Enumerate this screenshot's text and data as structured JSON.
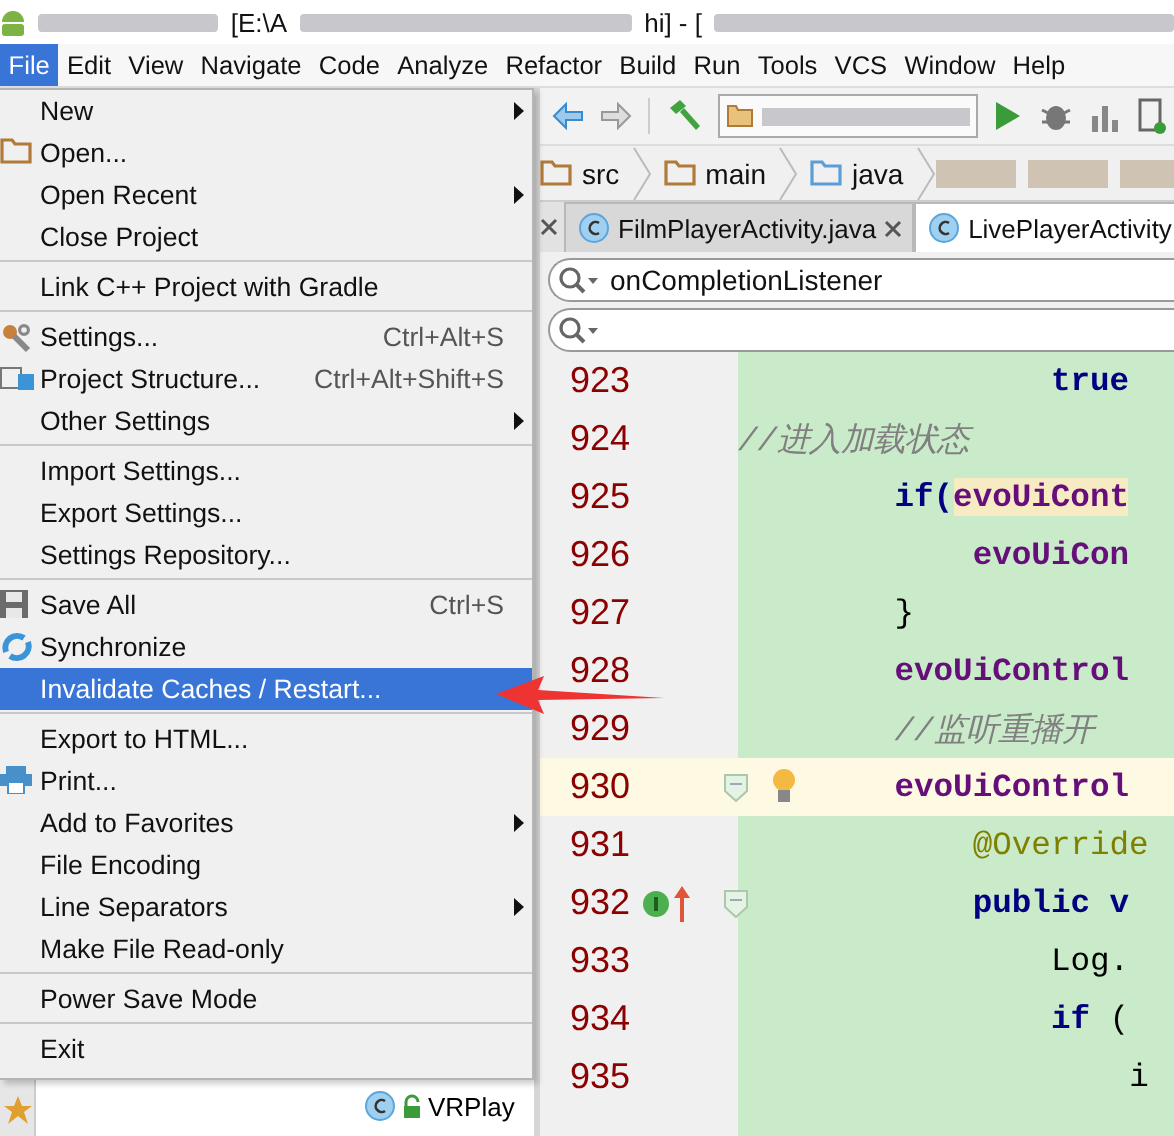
{
  "title_bar": {
    "parts": [
      "[E:\\A",
      "hi] - ["
    ]
  },
  "menu_bar": [
    {
      "label": "File",
      "selected": true
    },
    {
      "label": "Edit",
      "selected": false
    },
    {
      "label": "View",
      "selected": false
    },
    {
      "label": "Navigate",
      "selected": false
    },
    {
      "label": "Code",
      "selected": false
    },
    {
      "label": "Analyze",
      "selected": false
    },
    {
      "label": "Refactor",
      "selected": false
    },
    {
      "label": "Build",
      "selected": false
    },
    {
      "label": "Run",
      "selected": false
    },
    {
      "label": "Tools",
      "selected": false
    },
    {
      "label": "VCS",
      "selected": false
    },
    {
      "label": "Window",
      "selected": false
    },
    {
      "label": "Help",
      "selected": false
    }
  ],
  "breadcrumbs": [
    "src",
    "main",
    "java"
  ],
  "tabs": [
    {
      "label": "FilmPlayerActivity.java",
      "selected": false
    },
    {
      "label": "LivePlayerActivity",
      "selected": true
    }
  ],
  "search_fields": [
    {
      "value": "onCompletionListener"
    }
  ],
  "code": {
    "lines": [
      {
        "number": "923",
        "highlighted": false,
        "tokens": [
          {
            "text": "                true",
            "kind": "keyword"
          }
        ]
      },
      {
        "number": "924",
        "highlighted": false,
        "tokens": [
          {
            "text": "//进入加载状态",
            "kind": "comment"
          }
        ]
      },
      {
        "number": "925",
        "highlighted": false,
        "tokens": [
          {
            "text": "        if(",
            "kind": "keyword"
          },
          {
            "text": "evoUiCont",
            "kind": "match"
          }
        ]
      },
      {
        "number": "926",
        "highlighted": false,
        "tokens": [
          {
            "text": "            evoUiCon",
            "kind": "field"
          }
        ]
      },
      {
        "number": "927",
        "highlighted": false,
        "tokens": [
          {
            "text": "        }",
            "kind": "plain"
          }
        ]
      },
      {
        "number": "928",
        "highlighted": false,
        "tokens": [
          {
            "text": "        evoUiControl",
            "kind": "field"
          }
        ]
      },
      {
        "number": "929",
        "highlighted": false,
        "tokens": [
          {
            "text": "        //监听重播开",
            "kind": "comment"
          }
        ]
      },
      {
        "number": "930",
        "highlighted": true,
        "tokens": [
          {
            "text": "        evoUiControl",
            "kind": "field"
          }
        ]
      },
      {
        "number": "931",
        "highlighted": false,
        "tokens": [
          {
            "text": "            @Override",
            "kind": "annotation"
          }
        ]
      },
      {
        "number": "932",
        "highlighted": false,
        "tokens": [
          {
            "text": "            public v",
            "kind": "keyword"
          }
        ]
      },
      {
        "number": "933",
        "highlighted": false,
        "tokens": [
          {
            "text": "                Log.",
            "kind": "plain"
          }
        ]
      },
      {
        "number": "934",
        "highlighted": false,
        "tokens": [
          {
            "text": "                if",
            "kind": "keyword"
          },
          {
            "text": " (",
            "kind": "plain"
          }
        ]
      },
      {
        "number": "935",
        "highlighted": false,
        "tokens": [
          {
            "text": "                    i",
            "kind": "plain"
          }
        ]
      }
    ]
  },
  "file_menu": {
    "groups": [
      [
        {
          "label": "New",
          "submenu": true,
          "selected": false
        },
        {
          "label": "Open...",
          "submenu": false,
          "selected": false
        },
        {
          "label": "Open Recent",
          "submenu": true,
          "selected": false
        },
        {
          "label": "Close Project",
          "submenu": false,
          "selected": false
        }
      ],
      [
        {
          "label": "Link C++ Project with Gradle",
          "submenu": false,
          "selected": false
        }
      ],
      [
        {
          "label": "Settings...",
          "shortcut": "Ctrl+Alt+S",
          "submenu": false,
          "selected": false
        },
        {
          "label": "Project Structure...",
          "shortcut": "Ctrl+Alt+Shift+S",
          "submenu": false,
          "selected": false
        },
        {
          "label": "Other Settings",
          "submenu": true,
          "selected": false
        }
      ],
      [
        {
          "label": "Import Settings...",
          "submenu": false,
          "selected": false
        },
        {
          "label": "Export Settings...",
          "submenu": false,
          "selected": false
        },
        {
          "label": "Settings Repository...",
          "submenu": false,
          "selected": false
        }
      ],
      [
        {
          "label": "Save All",
          "shortcut": "Ctrl+S",
          "submenu": false,
          "selected": false
        },
        {
          "label": "Synchronize",
          "submenu": false,
          "selected": false
        },
        {
          "label": "Invalidate Caches / Restart...",
          "submenu": false,
          "selected": true
        }
      ],
      [
        {
          "label": "Export to HTML...",
          "submenu": false,
          "selected": false
        },
        {
          "label": "Print...",
          "submenu": false,
          "selected": false
        },
        {
          "label": "Add to Favorites",
          "submenu": true,
          "selected": false
        },
        {
          "label": "File Encoding",
          "submenu": false,
          "selected": false
        },
        {
          "label": "Line Separators",
          "submenu": true,
          "selected": false
        },
        {
          "label": "Make File Read-only",
          "submenu": false,
          "selected": false
        }
      ],
      [
        {
          "label": "Power Save Mode",
          "submenu": false,
          "selected": false
        }
      ],
      [
        {
          "label": "Exit",
          "submenu": false,
          "selected": false
        }
      ]
    ]
  },
  "project_tree": [
    {
      "label": "VRPlay"
    }
  ]
}
